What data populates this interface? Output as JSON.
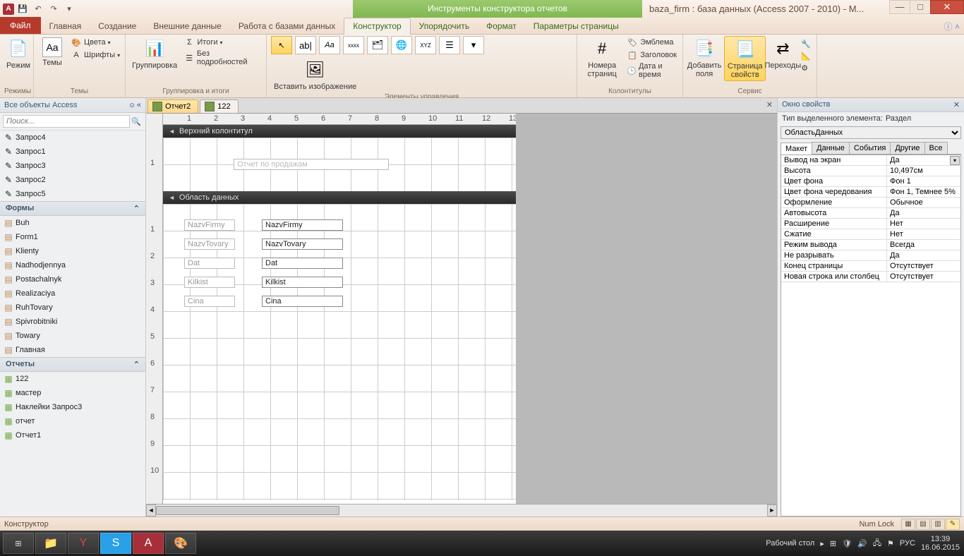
{
  "titlebar": {
    "app_letter": "A",
    "context_title": "Инструменты конструктора отчетов",
    "window_title": "baza_firm : база данных (Access 2007 - 2010) - M..."
  },
  "tabs": {
    "file": "Файл",
    "home": "Главная",
    "create": "Создание",
    "external": "Внешние данные",
    "dbtools": "Работа с базами данных",
    "design": "Конструктор",
    "arrange": "Упорядочить",
    "format": "Формат",
    "pagesetup": "Параметры страницы"
  },
  "ribbon": {
    "groups": {
      "modes": "Режимы",
      "themes": "Темы",
      "grouping": "Группировка и итоги",
      "controls": "Элементы управления",
      "headerfooter": "Колонтитулы",
      "service": "Сервис"
    },
    "view": "Режим",
    "themes_btn": "Темы",
    "colors": "Цвета",
    "fonts": "Шрифты",
    "groupby": "Группировка",
    "totals": "Итоги",
    "nodetails": "Без подробностей",
    "insertimg": "Вставить изображение",
    "pagenum": "Номера страниц",
    "emblem": "Эмблема",
    "header": "Заголовок",
    "datetime": "Дата и время",
    "addfields": "Добавить поля",
    "propsheet": "Страница свойств",
    "tabs_btn": "Переходы"
  },
  "nav": {
    "title": "Все объекты Access",
    "search_placeholder": "Поиск...",
    "queries": [
      "Запрос4",
      "Запрос1",
      "Запрос3",
      "Запрос2",
      "Запрос5"
    ],
    "forms_h": "Формы",
    "forms": [
      "Buh",
      "Form1",
      "Klienty",
      "Nadhodjennya",
      "Postachalnyk",
      "Realizaciya",
      "RuhTovary",
      "Spivrobitniki",
      "Towary",
      "Главная"
    ],
    "reports_h": "Отчеты",
    "reports": [
      "122",
      "мастер",
      "Наклейки Запрос3",
      "отчет",
      "Отчет1"
    ]
  },
  "doctabs": {
    "t1": "Отчет2",
    "t2": "122"
  },
  "sections": {
    "pageheader": "Верхний колонтитул",
    "detail": "Область данных"
  },
  "report_title_text": "Отчет по продажам",
  "fields": {
    "labels": [
      "NazvFirmy",
      "NazvTovary",
      "Dat",
      "Kilkist",
      "Cina"
    ],
    "controls": [
      "NazvFirmy",
      "NazvTovary",
      "Dat",
      "Kilkist",
      "Cina"
    ]
  },
  "props": {
    "title": "Окно свойств",
    "type_lbl": "Тип выделенного элемента:",
    "type_val": "Раздел",
    "selector": "ОбластьДанных",
    "tabs": [
      "Макет",
      "Данные",
      "События",
      "Другие",
      "Все"
    ],
    "rows": [
      {
        "k": "Вывод на экран",
        "v": "Да",
        "dd": true
      },
      {
        "k": "Высота",
        "v": "10,497см"
      },
      {
        "k": "Цвет фона",
        "v": "Фон 1"
      },
      {
        "k": "Цвет фона чередования",
        "v": "Фон 1, Темнее 5%"
      },
      {
        "k": "Оформление",
        "v": "Обычное"
      },
      {
        "k": "Автовысота",
        "v": "Да"
      },
      {
        "k": "Расширение",
        "v": "Нет"
      },
      {
        "k": "Сжатие",
        "v": "Нет"
      },
      {
        "k": "Режим вывода",
        "v": "Всегда"
      },
      {
        "k": "Не разрывать",
        "v": "Да"
      },
      {
        "k": "Конец страницы",
        "v": "Отсутствует"
      },
      {
        "k": "Новая строка или столбец",
        "v": "Отсутствует"
      }
    ]
  },
  "statusbar": {
    "mode": "Конструктор",
    "numlock": "Num Lock"
  },
  "taskbar": {
    "desktop": "Рабочий стол",
    "lang": "РУС",
    "time": "13:39",
    "date": "16.06.2015"
  }
}
